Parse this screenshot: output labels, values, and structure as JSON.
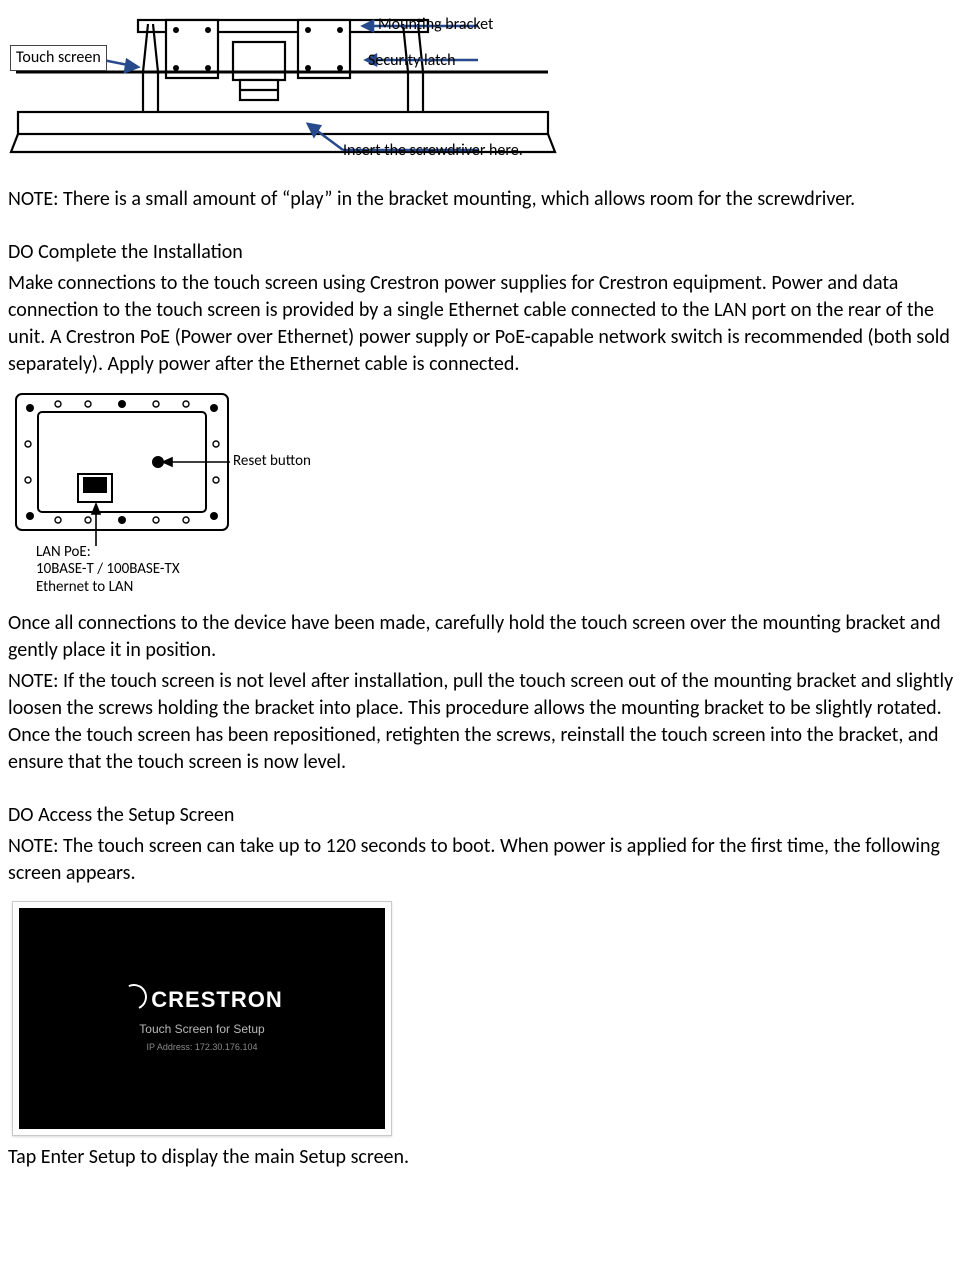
{
  "fig1": {
    "label_touch_screen": "Touch screen",
    "label_mounting_bracket": "Mounting bracket",
    "label_security_latch": "Security latch",
    "label_insert_screwdriver": "Insert the screwdriver here."
  },
  "note1": "NOTE:  There is a small amount of “play” in the bracket mounting, which allows room for the screwdriver.",
  "section_complete": {
    "heading": "DO Complete the Installation",
    "body": "Make connections to the touch screen using Crestron power supplies for Crestron equipment. Power and data connection to the touch screen is provided by a single Ethernet cable connected to the LAN port on the rear of the unit. A Crestron PoE (Power over Ethernet) power supply or PoE-capable network switch is recommended (both sold separately). Apply power after the Ethernet cable is connected."
  },
  "fig2": {
    "label_reset": "Reset button",
    "label_lan_line1": "LAN PoE:",
    "label_lan_line2": "10BASE-T / 100BASE-TX",
    "label_lan_line3": "Ethernet to LAN"
  },
  "para_after_fig2": "Once all connections to the device have been made, carefully hold the touch screen over the mounting bracket and gently place it in position.",
  "note2": "NOTE:  If the touch screen is not level after installation, pull the touch screen out of the mounting bracket and slightly loosen the screws holding the bracket into place. This procedure allows the mounting bracket to be slightly rotated. Once the touch screen has been repositioned, retighten the screws, reinstall the touch screen into the bracket, and ensure that the touch screen is now level.",
  "section_setup": {
    "heading": "DO Access the Setup Screen",
    "note": "NOTE:  The touch screen can take up to 120 seconds to boot. When power is applied for the first time, the following screen appears."
  },
  "fig3": {
    "logo": "CRESTRON",
    "subtitle": "Touch Screen for Setup",
    "ip_line": "IP Address: 172.30.176.104"
  },
  "closing": "Tap Enter Setup to display the main Setup screen."
}
